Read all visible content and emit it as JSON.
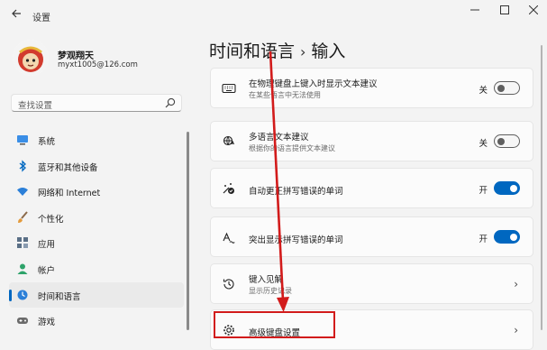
{
  "window": {
    "title": "设置",
    "back_icon": "back-arrow-icon",
    "controls": [
      "minimize-icon",
      "maximize-icon",
      "close-icon"
    ]
  },
  "user": {
    "name": "梦观翔天",
    "email": "myxt1005@126.com"
  },
  "search": {
    "placeholder": "查找设置"
  },
  "sidebar": {
    "items": [
      {
        "label": "系统",
        "icon": "monitor-icon"
      },
      {
        "label": "蓝牙和其他设备",
        "icon": "bluetooth-icon"
      },
      {
        "label": "网络和 Internet",
        "icon": "wifi-icon"
      },
      {
        "label": "个性化",
        "icon": "brush-icon"
      },
      {
        "label": "应用",
        "icon": "apps-icon"
      },
      {
        "label": "帐户",
        "icon": "person-icon"
      },
      {
        "label": "时间和语言",
        "icon": "globe-clock-icon",
        "active": true
      },
      {
        "label": "游戏",
        "icon": "gamepad-icon"
      }
    ]
  },
  "breadcrumb": {
    "parent": "时间和语言",
    "separator": "›",
    "current": "输入"
  },
  "settings": [
    {
      "title": "在物理键盘上键入时显示文本建议",
      "description": "在某些语言中无法使用",
      "state_label": "关",
      "toggle_on": false,
      "icon": "keyboard-icon"
    },
    {
      "title": "多语言文本建议",
      "description": "根据你的语言提供文本建议",
      "state_label": "关",
      "toggle_on": false,
      "icon": "multilingual-icon"
    },
    {
      "title": "自动更正拼写错误的单词",
      "description": "",
      "state_label": "开",
      "toggle_on": true,
      "icon": "autocorrect-icon"
    },
    {
      "title": "突出显示拼写错误的单词",
      "description": "",
      "state_label": "开",
      "toggle_on": true,
      "icon": "spellcheck-icon"
    },
    {
      "title": "键入见解",
      "description": "显示历史记录",
      "icon": "history-icon"
    },
    {
      "title": "高级键盘设置",
      "description": "",
      "icon": "gear-icon"
    }
  ],
  "colors": {
    "accent": "#0067c0",
    "annotation": "#d21b1b",
    "background": "#f3f3f3",
    "card": "#fbfbfb"
  }
}
